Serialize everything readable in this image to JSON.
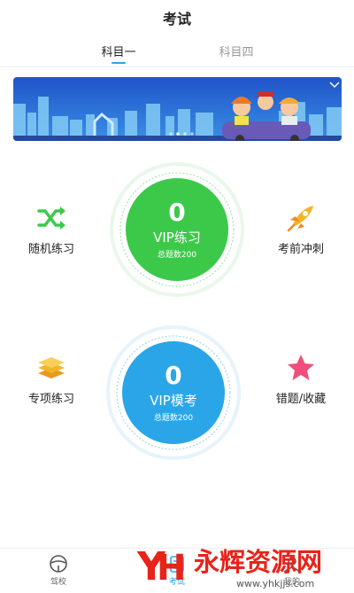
{
  "header": {
    "title": "考试"
  },
  "tabs": [
    {
      "label": "科目一",
      "active": true
    },
    {
      "label": "科目四",
      "active": false
    }
  ],
  "features": {
    "random": {
      "label": "随机练习",
      "icon": "shuffle-icon"
    },
    "sprint": {
      "label": "考前冲刺",
      "icon": "rocket-icon"
    },
    "special": {
      "label": "专项练习",
      "icon": "stacked-books-icon"
    },
    "wrong": {
      "label": "错题/收藏",
      "icon": "star-icon"
    }
  },
  "vip_practice": {
    "count": "0",
    "label": "VIP练习",
    "total": "总题数200",
    "color": "#3cc94a"
  },
  "vip_exam": {
    "count": "0",
    "label": "VIP模考",
    "total": "总题数200",
    "color": "#2aa6e8"
  },
  "bottom_nav": [
    {
      "label": "驾校",
      "icon": "steering-wheel-icon"
    },
    {
      "label": "考试",
      "icon": "exam-icon"
    },
    {
      "label": "我的",
      "icon": "user-icon"
    }
  ],
  "watermark": {
    "text": "永辉资源网",
    "url": "www.yhkjjs.com"
  }
}
